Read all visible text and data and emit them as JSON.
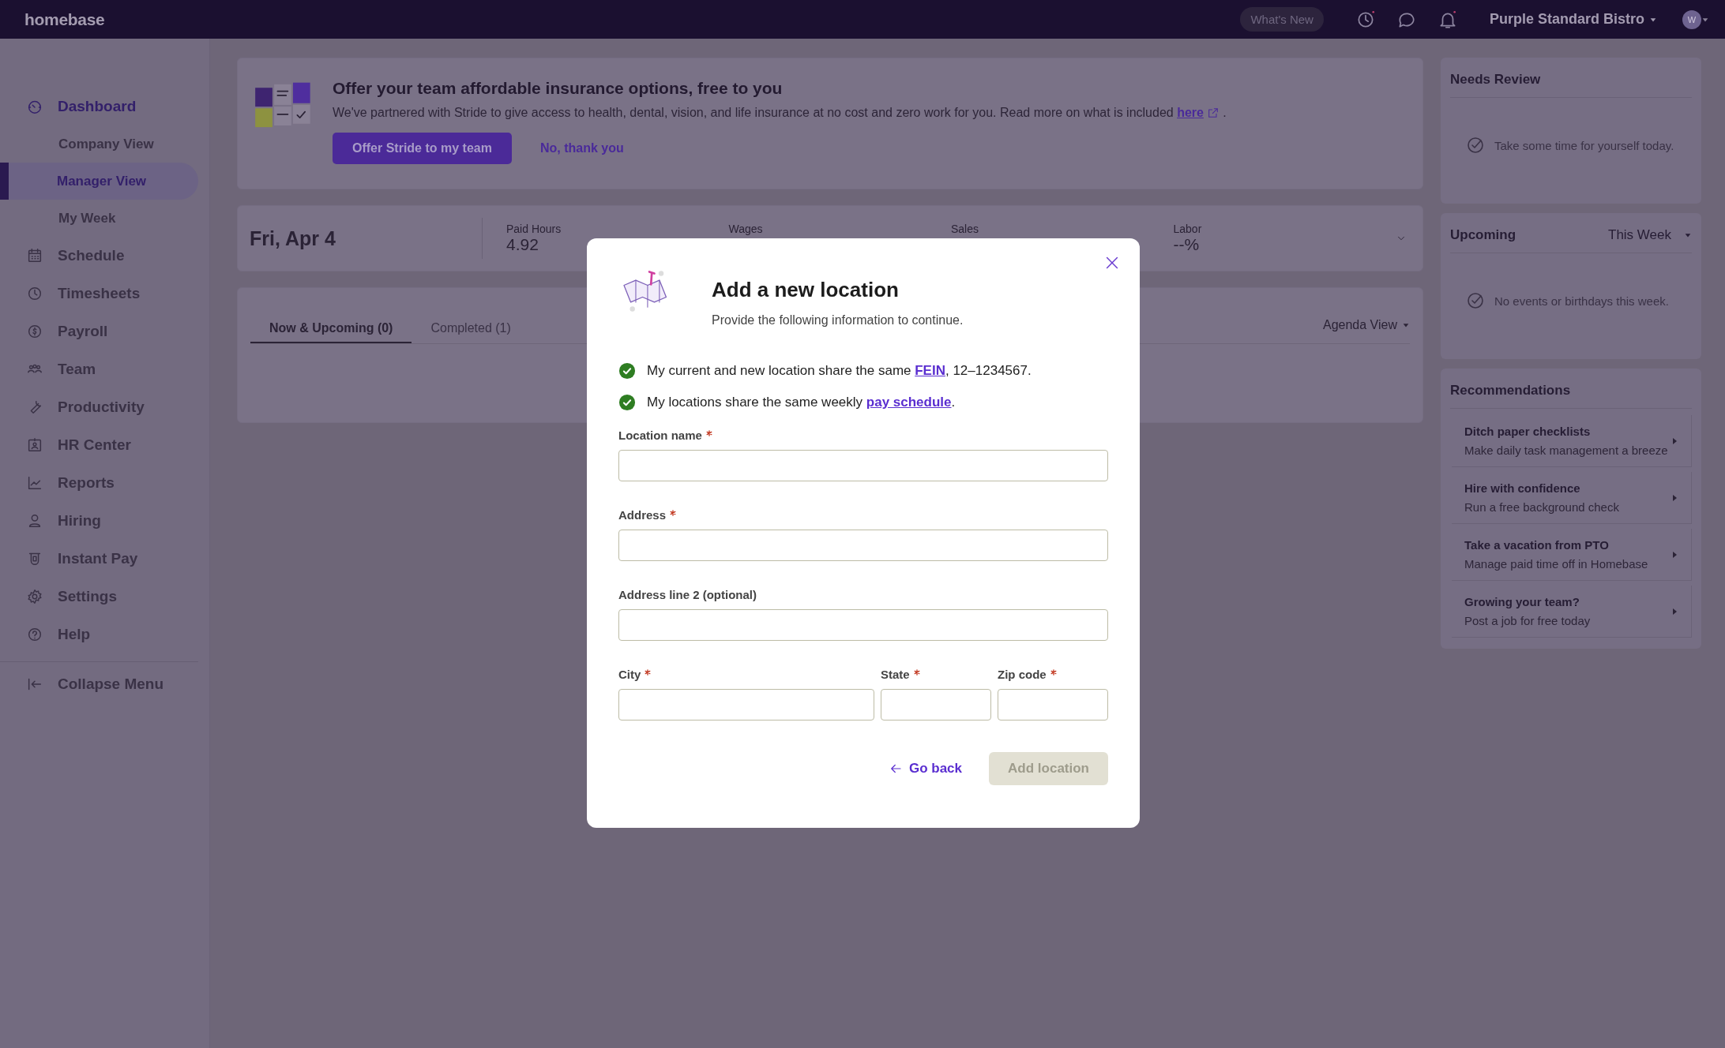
{
  "topbar": {
    "logo": "homebase",
    "whats_new": "What's New",
    "location": "Purple Standard Bistro",
    "avatar": "W"
  },
  "sidebar": {
    "items": [
      {
        "label": "Dashboard",
        "selected": true,
        "children": [
          {
            "label": "Company View",
            "selected": false
          },
          {
            "label": "Manager View",
            "selected": true
          },
          {
            "label": "My Week",
            "selected": false
          }
        ]
      },
      {
        "label": "Schedule",
        "selected": false
      },
      {
        "label": "Timesheets",
        "selected": false
      },
      {
        "label": "Payroll",
        "selected": false
      },
      {
        "label": "Team",
        "selected": false
      },
      {
        "label": "Productivity",
        "selected": false
      },
      {
        "label": "HR Center",
        "selected": false
      },
      {
        "label": "Reports",
        "selected": false
      },
      {
        "label": "Hiring",
        "selected": false
      },
      {
        "label": "Instant Pay",
        "selected": false
      },
      {
        "label": "Settings",
        "selected": false
      },
      {
        "label": "Help",
        "selected": false
      }
    ],
    "collapse": "Collapse Menu"
  },
  "banner": {
    "title": "Offer your team affordable insurance options, free to you",
    "text": "We've partnered with Stride to give access to health, dental, vision, and life insurance at no cost and zero work for you. Read more on what is included",
    "link": "here",
    "after": ".",
    "primary": "Offer Stride to my team",
    "secondary": "No, thank you"
  },
  "stats": {
    "date": "Fri, Apr 4",
    "items": [
      {
        "label": "Paid Hours",
        "value": "4.92"
      },
      {
        "label": "Wages"
      },
      {
        "label": "Sales"
      },
      {
        "label": "Labor",
        "value": "--%"
      }
    ]
  },
  "tabs": [
    {
      "label": "Now & Upcoming (0)",
      "selected": true
    },
    {
      "label": "Completed (1)",
      "selected": false
    }
  ],
  "view": "Agenda View",
  "needs_review": {
    "title": "Needs Review",
    "message": "Take some time for yourself today."
  },
  "upcoming": {
    "title": "Upcoming",
    "filter": "This Week",
    "message": "No events or birthdays this week."
  },
  "recommendations": {
    "title": "Recommendations",
    "items": [
      {
        "title": "Ditch paper checklists",
        "subtitle": "Make daily task management a breeze"
      },
      {
        "title": "Hire with confidence",
        "subtitle": "Run a free background check"
      },
      {
        "title": "Take a vacation from PTO",
        "subtitle": "Manage paid time off in Homebase"
      },
      {
        "title": "Growing your team?",
        "subtitle": "Post a job for free today"
      }
    ]
  },
  "modal": {
    "title": "Add a new location",
    "subtitle": "Provide the following information to continue.",
    "checks": [
      {
        "before": "My current and new location share the same ",
        "link": "FEIN",
        "after": ", 12–1234567.",
        "checked": true
      },
      {
        "before": "My locations share the same weekly ",
        "link": "pay schedule",
        "after": ".",
        "checked": true
      }
    ],
    "fields": [
      {
        "label": "Location name",
        "required": true
      },
      {
        "label": "Address",
        "required": true
      },
      {
        "label": "Address line 2 (optional)",
        "required": false
      }
    ],
    "row_fields": [
      {
        "label": "City",
        "required": true
      },
      {
        "label": "State",
        "required": true
      },
      {
        "label": "Zip code",
        "required": true
      }
    ],
    "back": "Go back",
    "submit": "Add location",
    "submit_disabled": true
  }
}
